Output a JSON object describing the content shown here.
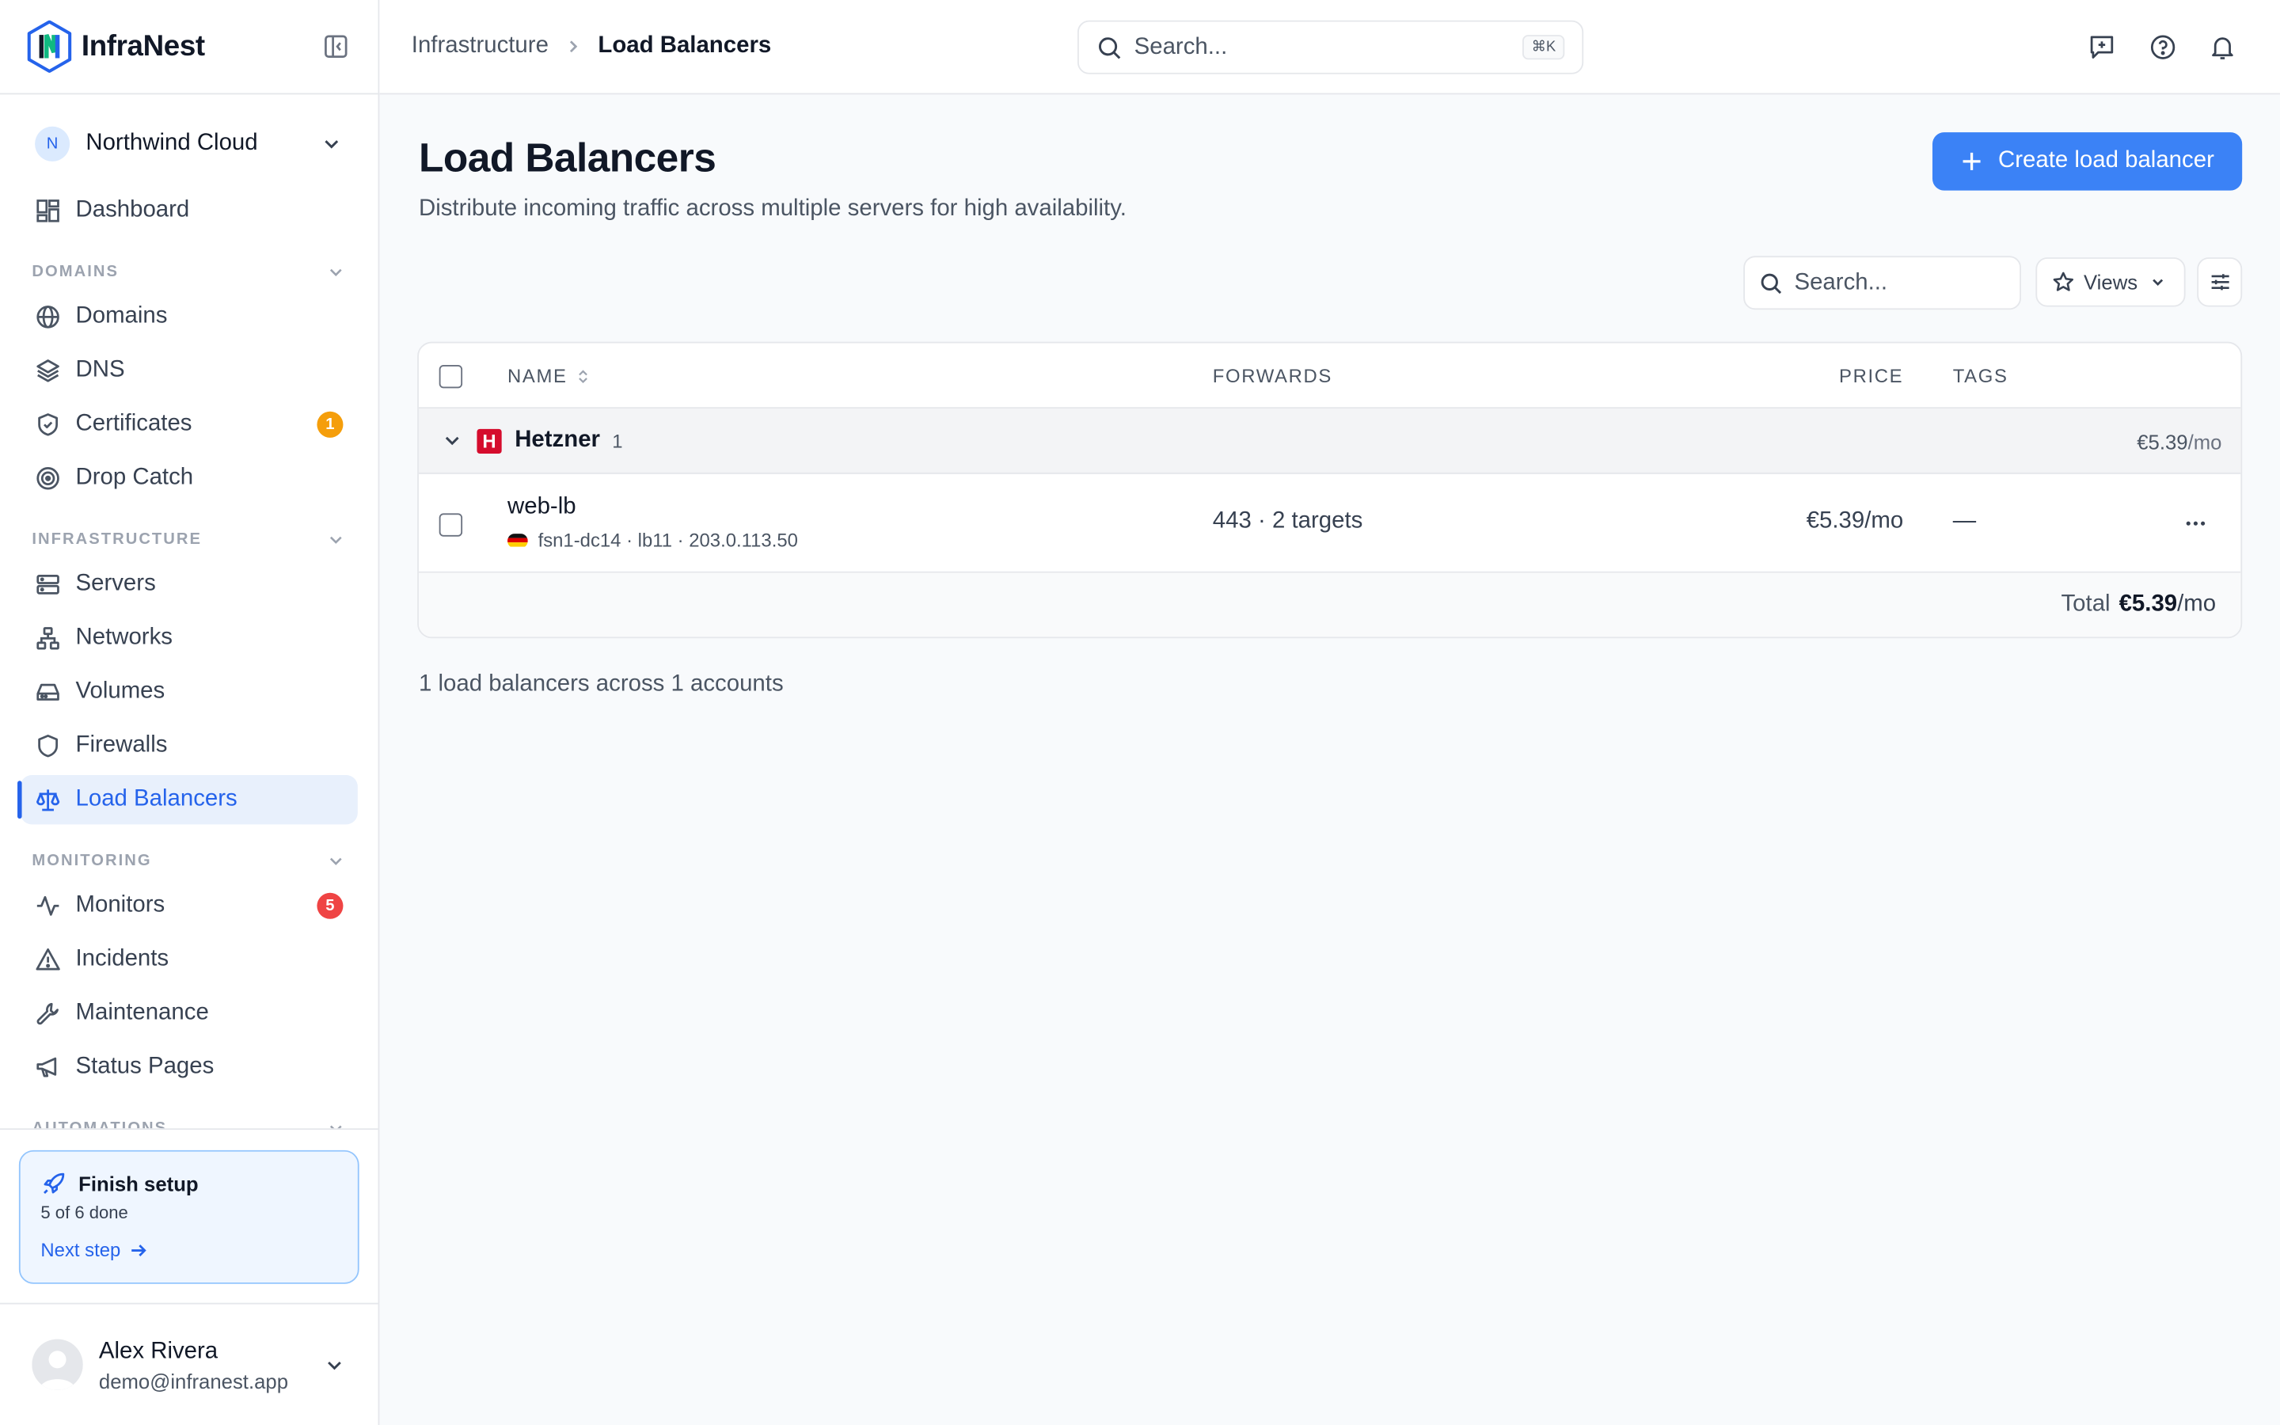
{
  "brand": {
    "name": "InfraNest",
    "accent": "#2563eb"
  },
  "workspace": {
    "initial": "N",
    "name": "Northwind Cloud"
  },
  "nav": {
    "dashboard": "Dashboard",
    "sections": {
      "domains": "DOMAINS",
      "infrastructure": "INFRASTRUCTURE",
      "monitoring": "MONITORING",
      "automations": "AUTOMATIONS"
    },
    "items": {
      "domains": "Domains",
      "dns": "DNS",
      "certificates": "Certificates",
      "certificates_badge": "1",
      "drop_catch": "Drop Catch",
      "servers": "Servers",
      "networks": "Networks",
      "volumes": "Volumes",
      "firewalls": "Firewalls",
      "load_balancers": "Load Balancers",
      "monitors": "Monitors",
      "monitors_badge": "5",
      "incidents": "Incidents",
      "maintenance": "Maintenance",
      "status_pages": "Status Pages"
    },
    "active": "load_balancers"
  },
  "setup": {
    "title": "Finish setup",
    "progress": "5 of 6 done",
    "next": "Next step"
  },
  "user": {
    "name": "Alex Rivera",
    "email": "demo@infranest.app"
  },
  "topbar": {
    "breadcrumb": [
      "Infrastructure",
      "Load Balancers"
    ],
    "search_placeholder": "Search...",
    "shortcut": "⌘K"
  },
  "page": {
    "title": "Load Balancers",
    "subtitle": "Distribute incoming traffic across multiple servers for high availability.",
    "create_label": "Create load balancer",
    "search_placeholder": "Search...",
    "views_label": "Views"
  },
  "table": {
    "columns": {
      "name": "NAME",
      "forwards": "FORWARDS",
      "price": "PRICE",
      "tags": "TAGS"
    },
    "group": {
      "logo_letter": "H",
      "name": "Hetzner",
      "count": "1",
      "price": "€5.39",
      "unit": "/mo"
    },
    "rows": [
      {
        "name": "web-lb",
        "meta": "fsn1-dc14 · lb11 · 203.0.113.50",
        "forwards": "443 · 2 targets",
        "price": "€5.39/mo",
        "tags": "—"
      }
    ],
    "total_label": "Total",
    "total_value": "€5.39",
    "total_unit": "/mo"
  },
  "summary": "1 load balancers across 1 accounts",
  "colors": {
    "primary_button": "#3b82f6",
    "badge_warning": "#f59e0b",
    "badge_danger": "#ef4444",
    "hetzner_red": "#d50c2d"
  }
}
